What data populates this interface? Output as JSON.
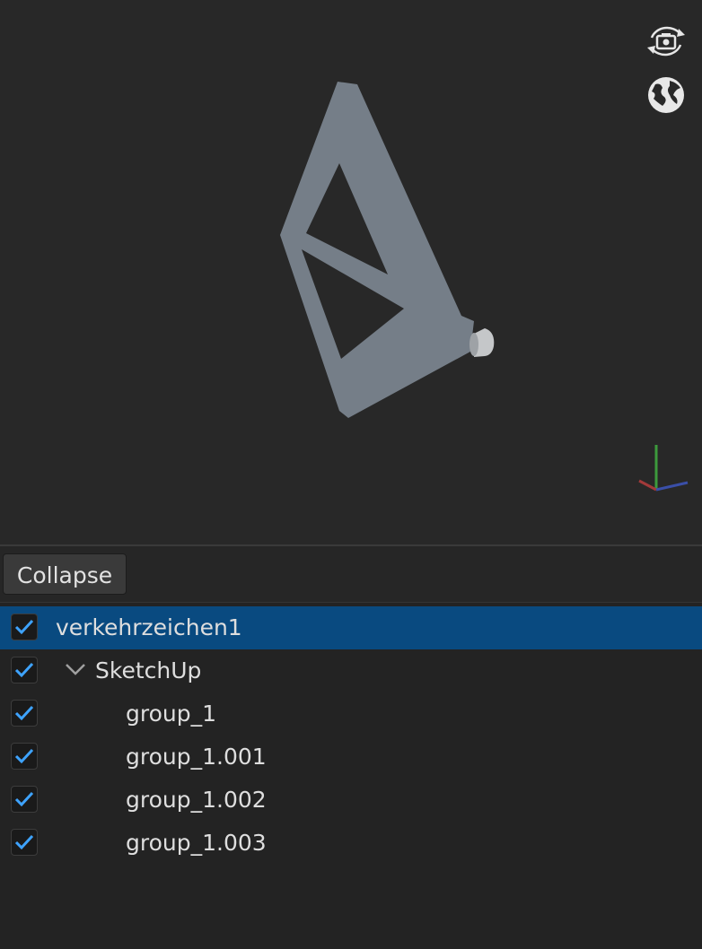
{
  "viewport": {
    "icons": {
      "orbit": "camera-orbit-icon",
      "globe": "globe-icon",
      "axes": "axis-gizmo-icon"
    },
    "model_color": "#757e88"
  },
  "toolbar": {
    "collapse_label": "Collapse"
  },
  "tree": {
    "items": [
      {
        "label": "verkehrzeichen1",
        "checked": true,
        "selected": true
      },
      {
        "label": "SketchUp",
        "checked": true,
        "expanded": true
      },
      {
        "label": "group_1",
        "checked": true
      },
      {
        "label": "group_1.001",
        "checked": true
      },
      {
        "label": "group_1.002",
        "checked": true
      },
      {
        "label": "group_1.003",
        "checked": true
      }
    ]
  },
  "colors": {
    "check": "#3ea3ff",
    "selection": "#094a80",
    "background": "#232323"
  }
}
